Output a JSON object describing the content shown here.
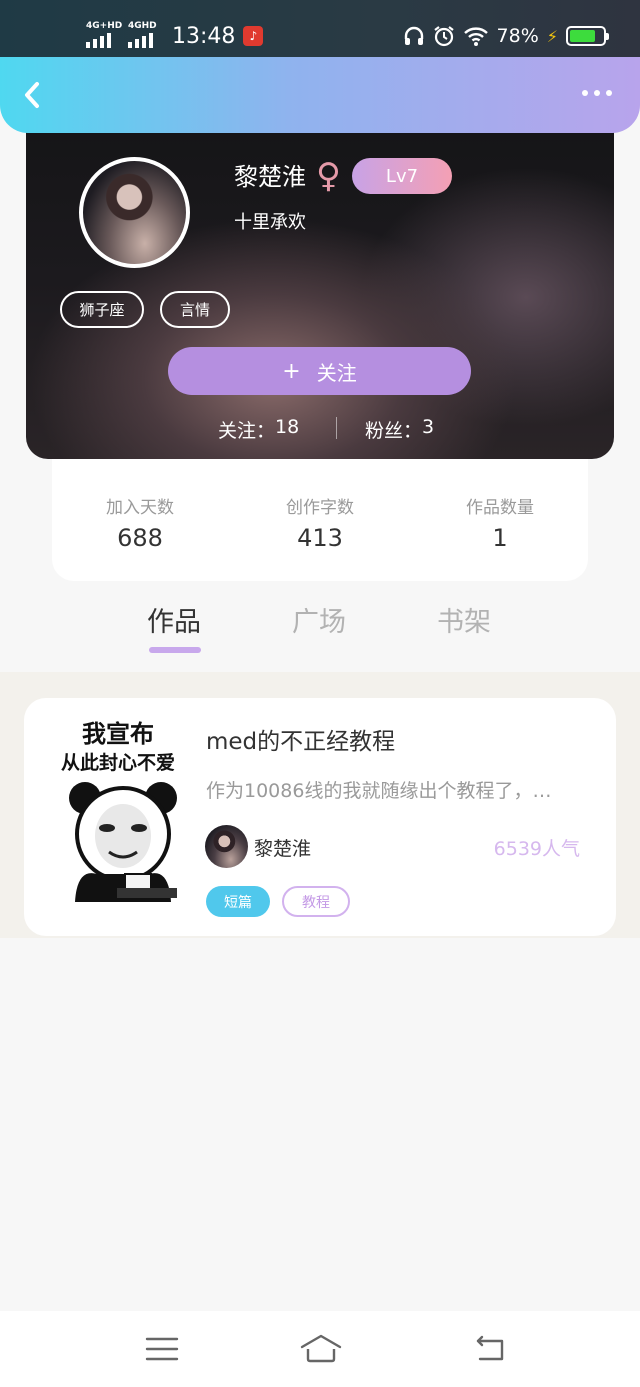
{
  "status_bar": {
    "network1": "4G+HD",
    "network2": "4GHD",
    "time": "13:48",
    "battery_pct": "78%",
    "battery_level": 0.78,
    "icons": [
      "signal-icon",
      "netease-music-icon",
      "headphones-icon",
      "alarm-icon",
      "wifi-icon",
      "charging-icon",
      "battery-icon"
    ]
  },
  "header": {
    "back_icon": "chevron-left-icon",
    "more_icon": "more-dots-icon"
  },
  "profile": {
    "name": "黎楚淮",
    "gender_symbol": "♀",
    "level": "Lv7",
    "signature": "十里承欢",
    "tags": [
      "狮子座",
      "言情"
    ],
    "follow_button": {
      "plus": "+",
      "label": "关注"
    },
    "following_label": "关注：",
    "following_count": "18",
    "fans_label": "粉丝：",
    "fans_count": "3"
  },
  "stats": [
    {
      "label": "加入天数",
      "value": "688"
    },
    {
      "label": "创作字数",
      "value": "413"
    },
    {
      "label": "作品数量",
      "value": "1"
    }
  ],
  "tabs": [
    {
      "label": "作品",
      "active": true
    },
    {
      "label": "广场",
      "active": false
    },
    {
      "label": "书架",
      "active": false
    }
  ],
  "works": [
    {
      "cover_line1": "我宣布",
      "cover_line2": "从此封心不爱",
      "title": "med的不正经教程",
      "description": "作为10086线的我就随缘出个教程了，…",
      "author": "黎楚淮",
      "popularity": "6539人气",
      "tags": [
        "短篇",
        "教程"
      ]
    }
  ],
  "colors": {
    "header_gradient": [
      "#4fd8f0",
      "#b8a4ec"
    ],
    "follow_button": "#b58fe0",
    "tab_underline": "#c8a8ec",
    "chip_short": "#50c8ec",
    "popularity": "#d6b8ee"
  },
  "nav_icons": [
    "menu-icon",
    "home-icon",
    "back-icon"
  ]
}
